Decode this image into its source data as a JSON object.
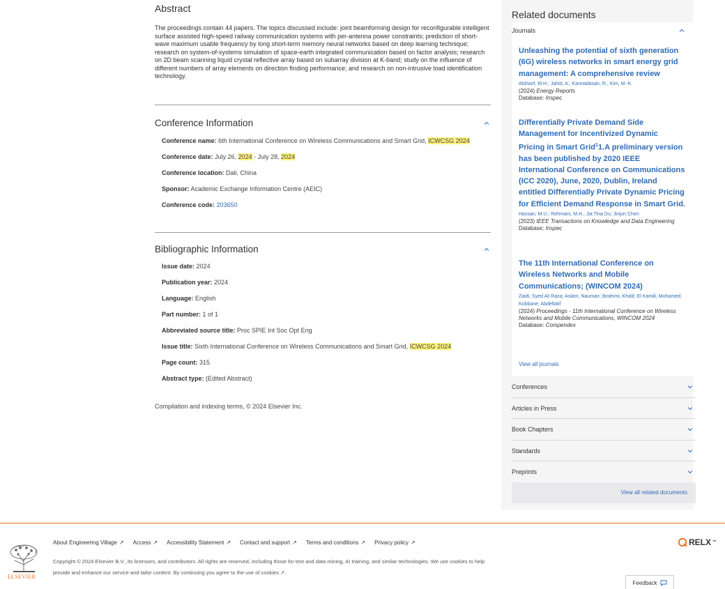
{
  "abstract": {
    "title": "Abstract",
    "text": "The proceedings contain 44 papers. The topics discussed include: joint beamforming design for reconfigurable intelligent surface assisted high-speed railway communication systems with per-antenna power constraints; prediction of short-wave maximum usable frequency by long short-term memory neural networks based on deep learning technique; research on system-of-systems simulation of space-earth integrated communication based on factor analysis; research on 2D beam scanning liquid crystal reflective array based on subarray division at K-band; study on the influence of different numbers of array elements on direction finding performance; and research on non-intrusive load identification technology."
  },
  "conference": {
    "title": "Conference Information",
    "name_label": "Conference name:",
    "name_value": "6th International Conference on Wireless Communications and Smart Grid,",
    "name_highlight": "ICWCSG 2024",
    "date_label": "Conference date:",
    "date_part1": "July 26,",
    "date_hl1": "2024",
    "date_part2": "- July 28,",
    "date_hl2": "2024",
    "location_label": "Conference location:",
    "location_value": "Dali, China",
    "sponsor_label": "Sponsor:",
    "sponsor_value": "Academic Exchange Information Centre (AEIC)",
    "code_label": "Conference code:",
    "code_value": "203650"
  },
  "bibliographic": {
    "title": "Bibliographic Information",
    "issue_date_label": "Issue date:",
    "issue_date_value": "2024",
    "pub_year_label": "Publication year:",
    "pub_year_value": "2024",
    "language_label": "Language:",
    "language_value": "English",
    "part_label": "Part number:",
    "part_value": "1 of 1",
    "abbrev_label": "Abbreviated source title:",
    "abbrev_value": "Proc SPIE Int Soc Opt Eng",
    "issue_title_label": "Issue title:",
    "issue_title_value": "Sixth International Conference on Wireless Communications and Smart Grid,",
    "issue_title_highlight": "ICWCSG 2024",
    "page_count_label": "Page count:",
    "page_count_value": "315",
    "abstract_type_label": "Abstract type:",
    "abstract_type_value": "(Edited Abstract)"
  },
  "compilation": "Compilation and indexing terms, © 2024 Elsevier Inc.",
  "sidebar": {
    "title": "Related documents",
    "journals_label": "Journals",
    "docs": [
      {
        "title": "Unleashing the potential of sixth generation (6G) wireless networks in smart energy grid management: A comprehensive review",
        "authors": "Alsharif, M.H.;  Jahid, A.;  Kannadasan, R.; Kim, M.-K.",
        "year": "(2024)",
        "source": "Energy Reports",
        "db_label": "Database:",
        "db": "Inspec"
      },
      {
        "title_part1": "Differentially Private Demand Side Management for Incentivized Dynamic Pricing in Smart Grid",
        "title_sup": "1",
        "title_part2": "1.A preliminary version has been published by 2020 IEEE International Conference on Communications (ICC 2020), June, 2020, Dublin, Ireland entitled Differentially Private Dynamic Pricing for Efficient Demand Response in Smart Grid.",
        "authors": "Hassan, M.U.; Rehmani, M.H.; Jia Tina Du; Jinjun Chen",
        "year": "(2023)",
        "source": "IEEE Transactions on Knowledge and Data Engineering",
        "db_label": "Database:",
        "db": "Inspec"
      },
      {
        "title": "The 11th International Conference on Wireless Networks and Mobile Communications; (WINCOM 2024)",
        "authors": "Zaidi, Syed Ali Raza; Aslam, Nauman; Ibrahimi, Khalil; El Kamili, Mohamed; Kobbane, Abdellatif",
        "year": "(2024)",
        "source": "Proceedings - 11th International Conference on Wireless Networks and Mobile Communications, WINCOM 2024",
        "db_label": "Database:",
        "db": "Compendex"
      }
    ],
    "view_all_journals": "View all journals",
    "categories": [
      "Conferences",
      "Articles in Press",
      "Book Chapters",
      "Standards",
      "Preprints"
    ],
    "view_all_related": "View all related documents"
  },
  "footer": {
    "links": [
      "About Engineering Village",
      "Access",
      "Accessibility Statement",
      "Contact and support",
      "Terms and conditions",
      "Privacy policy"
    ],
    "copyright": "Copyright © 2024 Elsevier B.V., its licensors, and contributors. All rights are reserved, including those for text and data mining, AI training, and similar technologies. We use cookies to help provide and enhance our service and tailor content. By continuing you agree to the use of cookies",
    "elsevier": "ELSEVIER",
    "relx": "RELX",
    "relx_tm": "™",
    "feedback": "Feedback"
  },
  "colors": {
    "accent_link": "#2f6bb5",
    "footer_line": "#e9711c",
    "highlight": "#fff27a"
  }
}
